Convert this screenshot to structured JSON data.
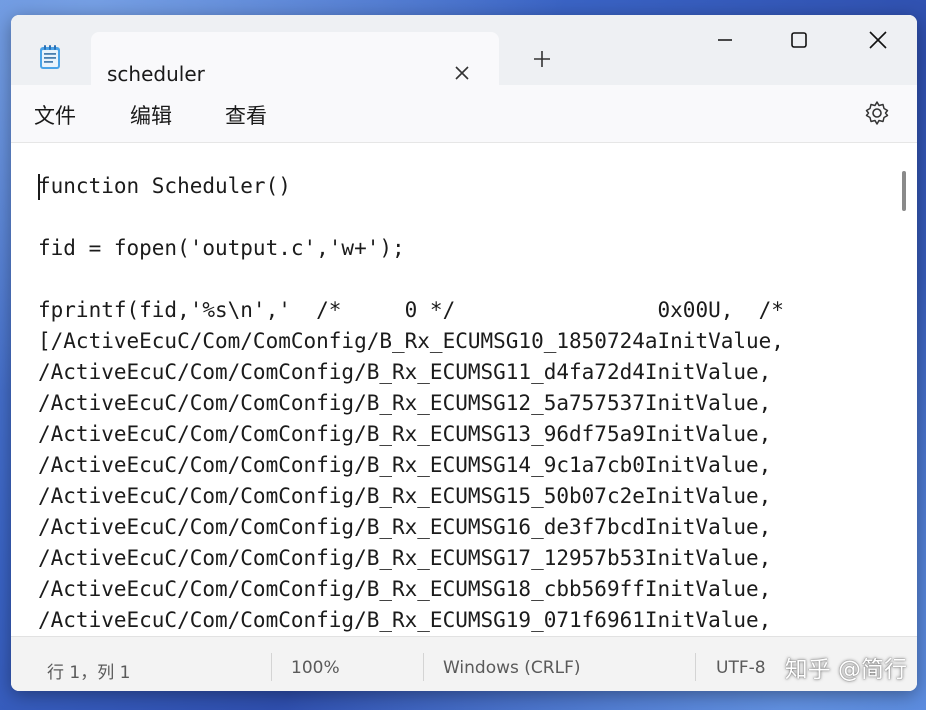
{
  "window": {
    "tab_title": "scheduler"
  },
  "menu": {
    "items": [
      "文件",
      "编辑",
      "查看"
    ]
  },
  "editor": {
    "lines": [
      "function Scheduler()",
      "fid = fopen('output.c','w+');",
      "fprintf(fid,'%s\\n','  /*     0 */                0x00U,  /*",
      "[/ActiveEcuC/Com/ComConfig/B_Rx_ECUMSG10_1850724aInitValue,",
      "/ActiveEcuC/Com/ComConfig/B_Rx_ECUMSG11_d4fa72d4InitValue,",
      "/ActiveEcuC/Com/ComConfig/B_Rx_ECUMSG12_5a757537InitValue,",
      "/ActiveEcuC/Com/ComConfig/B_Rx_ECUMSG13_96df75a9InitValue,",
      "/ActiveEcuC/Com/ComConfig/B_Rx_ECUMSG14_9c1a7cb0InitValue,",
      "/ActiveEcuC/Com/ComConfig/B_Rx_ECUMSG15_50b07c2eInitValue,",
      "/ActiveEcuC/Com/ComConfig/B_Rx_ECUMSG16_de3f7bcdInitValue,",
      "/ActiveEcuC/Com/ComConfig/B_Rx_ECUMSG17_12957b53InitValue,",
      "/ActiveEcuC/Com/ComConfig/B_Rx_ECUMSG18_cbb569ffInitValue,",
      "/ActiveEcuC/Com/ComConfig/B_Rx_ECUMSG19_071f6961InitValue,"
    ]
  },
  "status": {
    "position": "行 1，列 1",
    "zoom": "100%",
    "line_ending": "Windows (CRLF)",
    "encoding": "UTF-8"
  },
  "watermark": "知乎 @简行",
  "icons": {
    "app": "notepad-icon",
    "close_tab": "close-icon",
    "new_tab": "plus-icon",
    "settings": "gear-icon"
  }
}
